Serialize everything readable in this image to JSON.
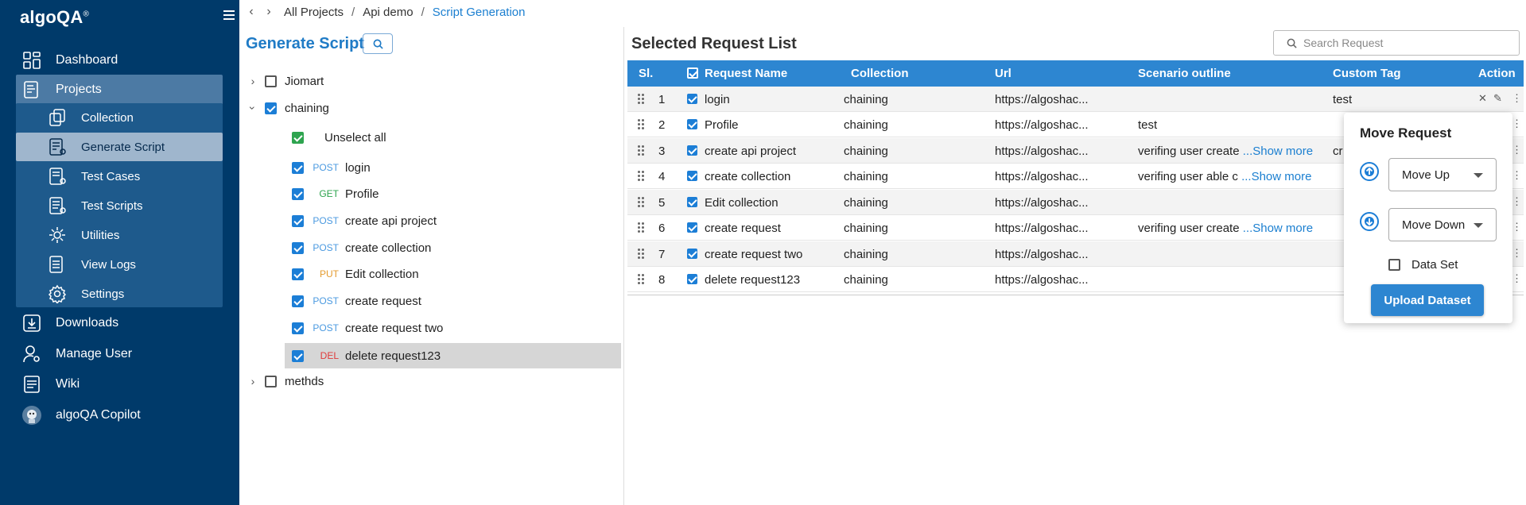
{
  "app": {
    "logo": "algoQA",
    "logo_mark": "®"
  },
  "sidebar": {
    "items": [
      {
        "label": "Dashboard",
        "icon": "dashboard-icon"
      },
      {
        "label": "Projects",
        "icon": "projects-icon"
      },
      {
        "label": "Downloads",
        "icon": "download-icon"
      },
      {
        "label": "Manage User",
        "icon": "user-gear-icon"
      },
      {
        "label": "Wiki",
        "icon": "wiki-icon"
      },
      {
        "label": "algoQA Copilot",
        "icon": "copilot-avatar-icon"
      }
    ],
    "subitems": [
      {
        "label": "Collection",
        "icon": "collection-icon"
      },
      {
        "label": "Generate Script",
        "icon": "script-icon"
      },
      {
        "label": "Test Cases",
        "icon": "test-cases-icon"
      },
      {
        "label": "Test Scripts",
        "icon": "test-scripts-icon"
      },
      {
        "label": "Utilities",
        "icon": "utilities-icon"
      },
      {
        "label": "View Logs",
        "icon": "logs-icon"
      },
      {
        "label": "Settings",
        "icon": "settings-icon"
      }
    ]
  },
  "breadcrumb": {
    "items": [
      "All Projects",
      "Api demo",
      "Script Generation"
    ],
    "separator": "/"
  },
  "tree": {
    "title": "Generate Script",
    "folders": [
      {
        "label": "Jiomart",
        "checked": false
      },
      {
        "label": "chaining",
        "checked": true
      },
      {
        "label": "methds",
        "checked": false
      }
    ],
    "unselect_all": "Unselect all",
    "requests": [
      {
        "method": "POST",
        "name": "login"
      },
      {
        "method": "GET",
        "name": "Profile"
      },
      {
        "method": "POST",
        "name": "create api project"
      },
      {
        "method": "POST",
        "name": "create collection"
      },
      {
        "method": "PUT",
        "name": "Edit collection"
      },
      {
        "method": "POST",
        "name": "create request"
      },
      {
        "method": "POST",
        "name": "create request two"
      },
      {
        "method": "DEL",
        "name": "delete request123"
      }
    ]
  },
  "main": {
    "title": "Selected Request List",
    "search_placeholder": "Search Request",
    "columns": [
      "Sl.",
      "Request Name",
      "Collection",
      "Url",
      "Scenario outline",
      "Custom Tag",
      "Action"
    ],
    "rows": [
      {
        "sl": "1",
        "name": "login",
        "collection": "chaining",
        "url": "https://algoshac...",
        "scenario": "",
        "more": "",
        "tag": "test"
      },
      {
        "sl": "2",
        "name": "Profile",
        "collection": "chaining",
        "url": "https://algoshac...",
        "scenario": "test",
        "more": "",
        "tag": ""
      },
      {
        "sl": "3",
        "name": "create api project",
        "collection": "chaining",
        "url": "https://algoshac...",
        "scenario": "verifing user create ",
        "more": "...Show more",
        "tag": "cr"
      },
      {
        "sl": "4",
        "name": "create collection",
        "collection": "chaining",
        "url": "https://algoshac...",
        "scenario": "verifing user able c ",
        "more": "...Show more",
        "tag": ""
      },
      {
        "sl": "5",
        "name": "Edit collection",
        "collection": "chaining",
        "url": "https://algoshac...",
        "scenario": "",
        "more": "",
        "tag": ""
      },
      {
        "sl": "6",
        "name": "create request",
        "collection": "chaining",
        "url": "https://algoshac...",
        "scenario": "verifing user create ",
        "more": "...Show more",
        "tag": ""
      },
      {
        "sl": "7",
        "name": "create request two",
        "collection": "chaining",
        "url": "https://algoshac...",
        "scenario": "",
        "more": "",
        "tag": ""
      },
      {
        "sl": "8",
        "name": "delete request123",
        "collection": "chaining",
        "url": "https://algoshac...",
        "scenario": "",
        "more": "",
        "tag": ""
      }
    ]
  },
  "popup": {
    "title": "Move Request",
    "move_up": "Move Up",
    "move_down": "Move Down",
    "dataset_label": "Data Set",
    "upload_label": "Upload Dataset"
  },
  "colors": {
    "sidebar": "#003a6a",
    "accent": "#2d86d1",
    "title_blue": "#1f7bc6"
  }
}
